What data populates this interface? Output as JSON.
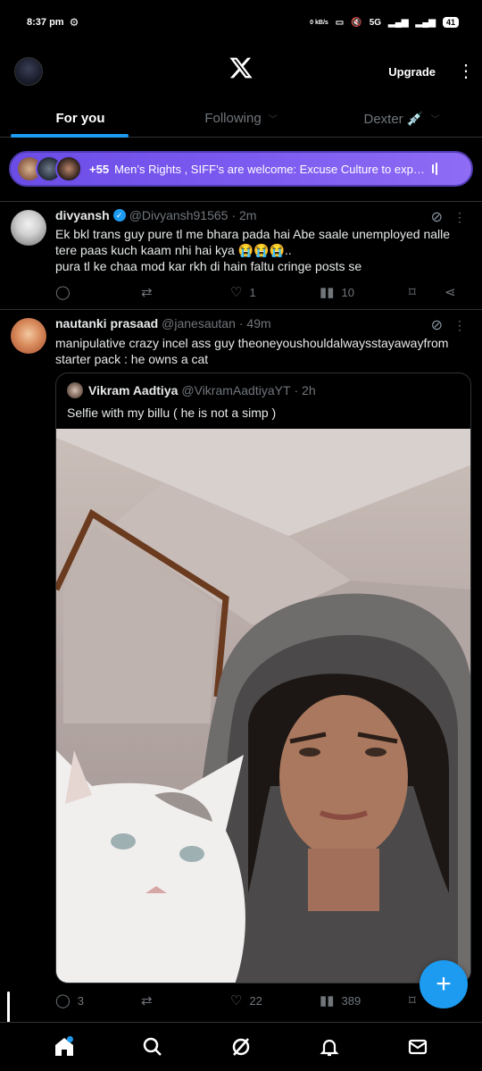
{
  "status_bar": {
    "time": "8:37 pm",
    "net_speed": "0 kB/s",
    "network": "5G",
    "battery": "41"
  },
  "header": {
    "logo": "x-logo-icon",
    "upgrade_label": "Upgrade"
  },
  "tabs": [
    {
      "label": "For you",
      "active": true
    },
    {
      "label": "Following",
      "active": false
    },
    {
      "label": "Dexter 💉",
      "active": false
    }
  ],
  "spaces_pill": {
    "count": "+55",
    "text": "Men’s Rights , SIFF’s are welcome: Excuse Culture to exp…",
    "color": "#7b5af0"
  },
  "posts": [
    {
      "name": "divyansh",
      "verified": true,
      "handle": "@Divyansh91565",
      "time": "· 2m",
      "text_line1": "Ek bkl trans guy pure tl me bhara pada hai Abe saale unemployed nalle",
      "text_line2": "tere paas kuch kaam nhi hai kya 😭😭😭..",
      "text_line3": "pura tl ke chaa mod kar rkh di hain faltu cringe posts se",
      "replies": "",
      "reposts": "",
      "likes": "1",
      "views": "10"
    },
    {
      "name": "nautanki prasaad",
      "handle": "@janesautan",
      "time": "· 49m",
      "text_line1": "manipulative crazy incel ass guy theoneyoushouldalwaysstayawayfrom",
      "text_line2": "starter pack : he owns a cat",
      "quote": {
        "name": "Vikram Aadtiya",
        "handle": "@VikramAadtiyaYT",
        "time": "· 2h",
        "text": "Selfie with my billu ( he is not a simp )"
      },
      "replies": "3",
      "reposts": "",
      "likes": "22",
      "views": "389"
    }
  ],
  "accent": "#1d9bf0",
  "bottom_nav": [
    "home-icon",
    "search-icon",
    "grok-icon",
    "notifications-icon",
    "messages-icon"
  ]
}
